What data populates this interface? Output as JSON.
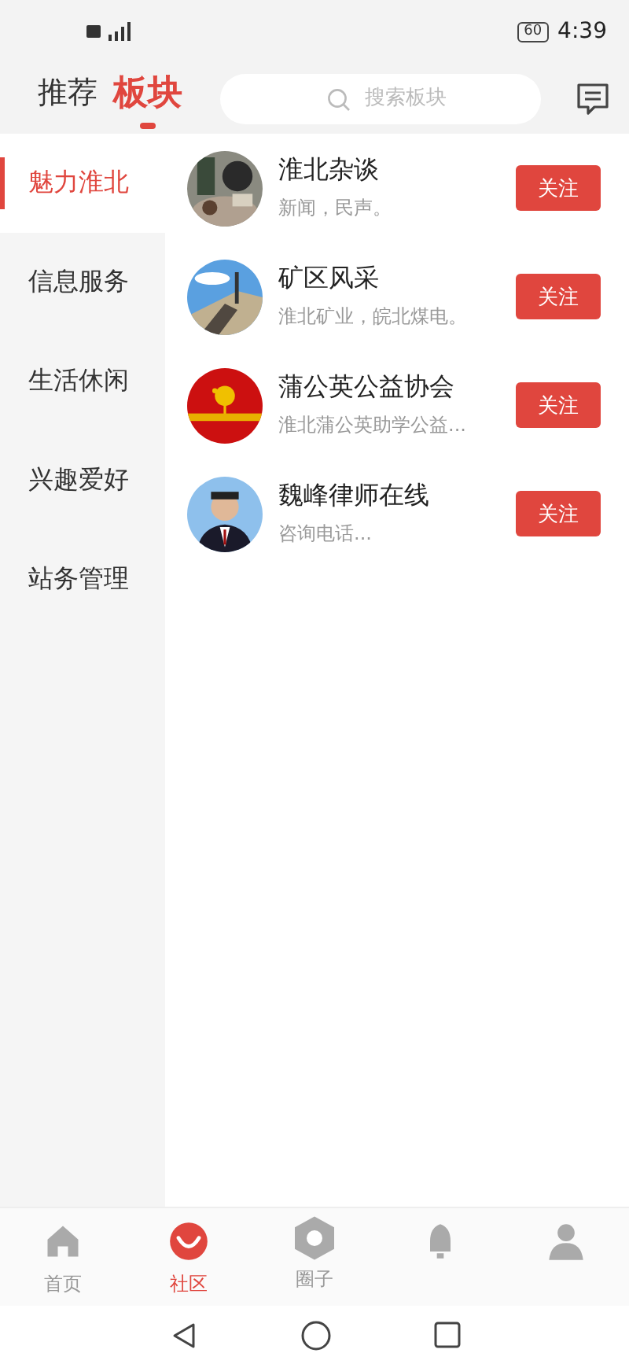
{
  "status_bar": {
    "battery": "60",
    "time": "4:39"
  },
  "header": {
    "tabs": [
      {
        "label": "推荐",
        "selected": false
      },
      {
        "label": "板块",
        "selected": true
      }
    ],
    "search": {
      "placeholder": "搜索板块"
    }
  },
  "sidebar": {
    "items": [
      {
        "label": "魅力淮北",
        "selected": true
      },
      {
        "label": "信息服务",
        "selected": false
      },
      {
        "label": "生活休闲",
        "selected": false
      },
      {
        "label": "兴趣爱好",
        "selected": false
      },
      {
        "label": "站务管理",
        "selected": false
      }
    ]
  },
  "boards": [
    {
      "name": "淮北杂谈",
      "desc": "新闻，民声。",
      "button": "关注"
    },
    {
      "name": "矿区风采",
      "desc": "淮北矿业，皖北煤电。",
      "button": "关注"
    },
    {
      "name": "蒲公英公益协会",
      "desc": "淮北蒲公英助学公益...",
      "button": "关注"
    },
    {
      "name": "魏峰律师在线",
      "desc": "咨询电话...",
      "button": "关注"
    }
  ],
  "bottom_nav": [
    {
      "kind": "home",
      "label": "首页",
      "selected": false
    },
    {
      "kind": "community",
      "label": "社区",
      "selected": true
    },
    {
      "kind": "circle",
      "label": "圈子",
      "selected": false
    },
    {
      "kind": "bell",
      "selected": false
    },
    {
      "kind": "person",
      "selected": false
    }
  ]
}
